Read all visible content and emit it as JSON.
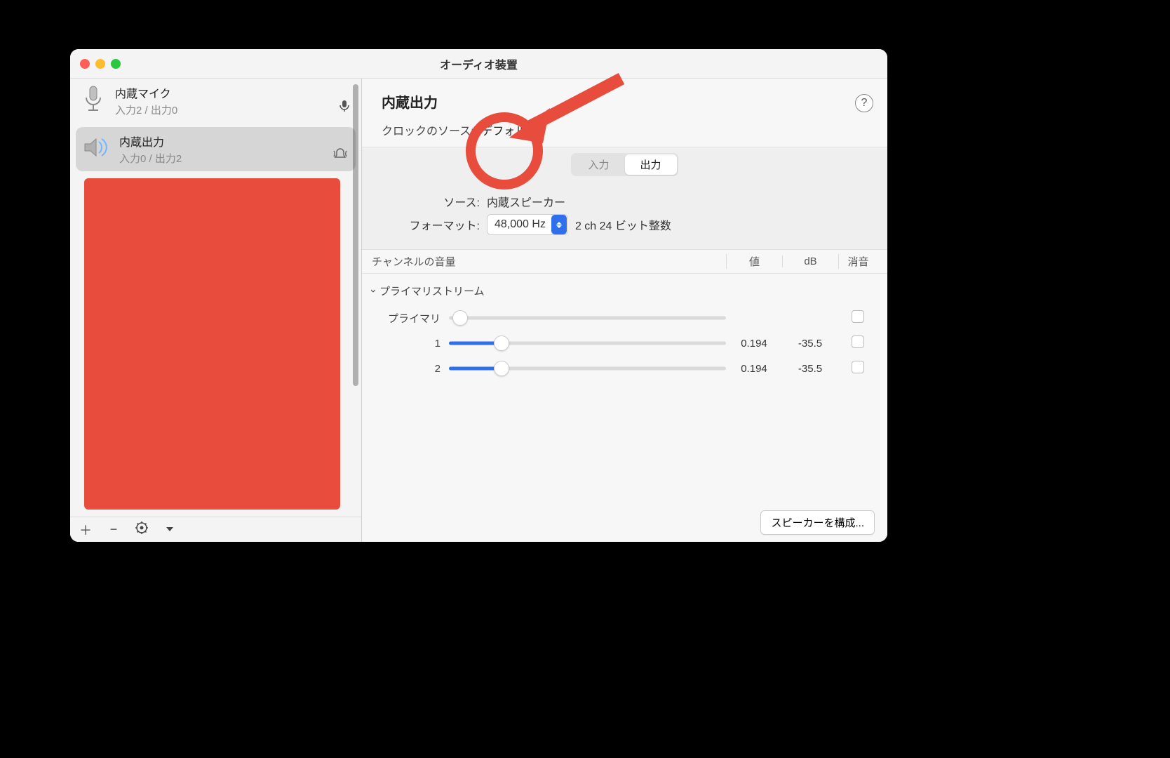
{
  "window": {
    "title": "オーディオ装置"
  },
  "sidebar": {
    "devices": [
      {
        "name": "内蔵マイク",
        "sub": "入力2 / 出力0",
        "badge": "mic"
      },
      {
        "name": "内蔵出力",
        "sub": "入力0 / 出力2",
        "badge": "notify"
      }
    ]
  },
  "detail": {
    "title": "内蔵出力",
    "clock_label": "クロックのソース:",
    "clock_value": "デフォルト",
    "tabs": {
      "input": "入力",
      "output": "出力",
      "active": "output"
    },
    "source_label": "ソース:",
    "source_value": "内蔵スピーカー",
    "format_label": "フォーマット:",
    "format_hz": "48,000 Hz",
    "format_desc": "2 ch 24 ビット整数",
    "columns": {
      "name": "チャンネルの音量",
      "val": "値",
      "db": "dB",
      "mute": "消音"
    },
    "stream_header": "プライマリストリーム",
    "primary_label": "プライマリ",
    "channels": [
      {
        "label": "1",
        "value": "0.194",
        "db": "-35.5",
        "pos": 0.19
      },
      {
        "label": "2",
        "value": "0.194",
        "db": "-35.5",
        "pos": 0.19
      }
    ],
    "footer_button": "スピーカーを構成..."
  },
  "annotation": {
    "color": "#e74c3c"
  }
}
